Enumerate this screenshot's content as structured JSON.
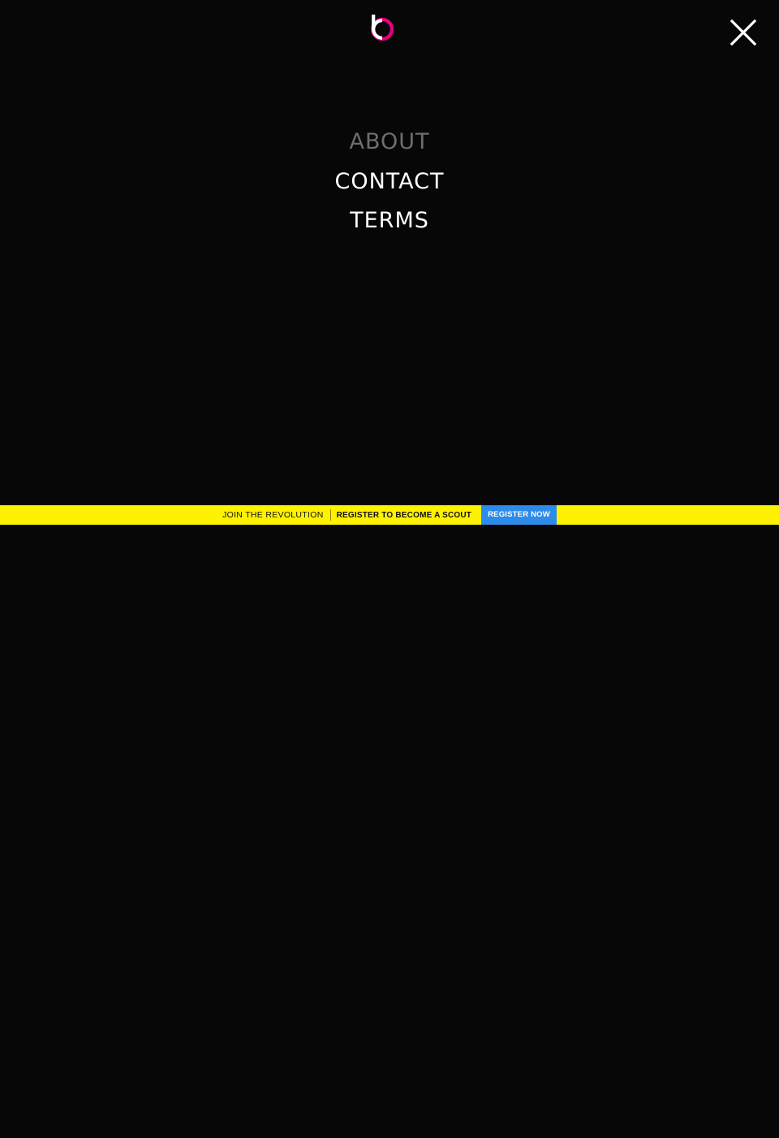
{
  "header": {
    "logo_icon": "brand-b-logo",
    "close_icon": "close-icon"
  },
  "menu": {
    "items": [
      {
        "label": "ABOUT",
        "active": true
      },
      {
        "label": "CONTACT",
        "active": false
      },
      {
        "label": "TERMS",
        "active": false
      }
    ]
  },
  "banner": {
    "join_text": "JOIN THE REVOLUTION",
    "cta_text": "REGISTER TO BECOME A SCOUT",
    "button_label": "REGISTER NOW"
  },
  "colors": {
    "background": "#070707",
    "banner": "#fff200",
    "button": "#2d8bea",
    "logo_accent": "#e6007e",
    "menu_active": "#6e6e6e",
    "menu_text": "#ffffff"
  }
}
